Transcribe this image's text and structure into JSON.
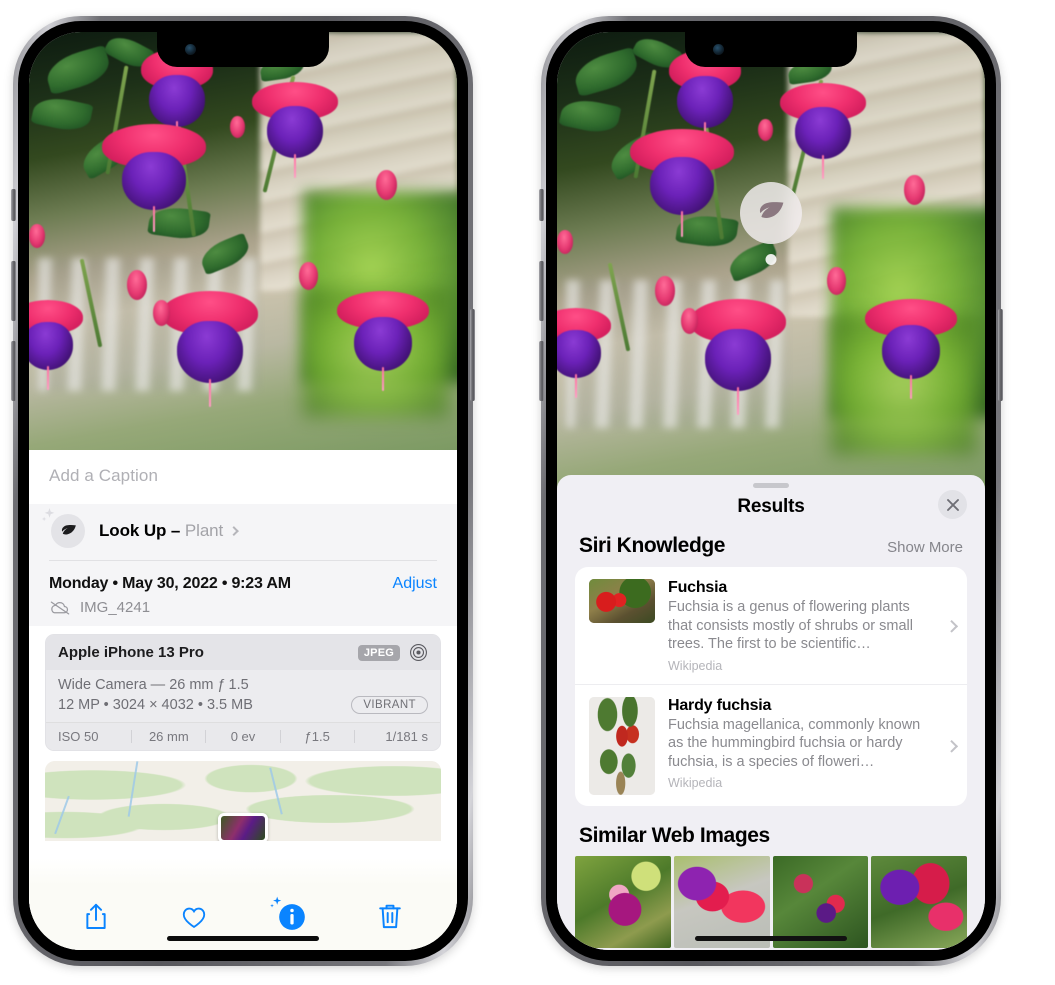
{
  "left_phone": {
    "photo_alt": "Fuchsia flowers hanging basket",
    "caption_placeholder": "Add a Caption",
    "lookup": {
      "label": "Look Up – ",
      "subject": "Plant",
      "icon": "leaf-icon",
      "sparkle_icon": "sparkle-icon"
    },
    "date": "Monday • May 30, 2022 • 9:23 AM",
    "adjust_label": "Adjust",
    "file_name": "IMG_4241",
    "cloud_icon": "icloud-slash-icon",
    "camera": {
      "device": "Apple iPhone 13 Pro",
      "format_chip": "JPEG",
      "aperture_icon": "aperture-icon",
      "lens_line": "Wide Camera — 26 mm ƒ 1.5",
      "size_line": "12 MP • 3024 × 4032 • 3.5 MB",
      "style_chip": "VIBRANT",
      "exif": [
        "ISO 50",
        "26 mm",
        "0 ev",
        "ƒ1.5",
        "1/181 s"
      ]
    },
    "toolbar": [
      {
        "name": "share-button",
        "icon": "share-icon"
      },
      {
        "name": "favorite-button",
        "icon": "heart-icon"
      },
      {
        "name": "info-visual-lookup-button",
        "icon": "info-sparkle-icon"
      },
      {
        "name": "delete-button",
        "icon": "trash-icon"
      }
    ],
    "accent_color": "#0a84ff"
  },
  "right_phone": {
    "visual_lookup_badge_icon": "leaf-icon",
    "results_title": "Results",
    "close_icon": "close-icon",
    "sections": [
      {
        "title": "Siri Knowledge",
        "action": "Show More",
        "items": [
          {
            "title": "Fuchsia",
            "description": "Fuchsia is a genus of flowering plants that consists mostly of shrubs or small trees. The first to be scientific…",
            "source": "Wikipedia",
            "thumb": "fuchsia-red-flowers-thumb"
          },
          {
            "title": "Hardy fuchsia",
            "description": "Fuchsia magellanica, commonly known as the hummingbird fuchsia or hardy fuchsia, is a species of floweri…",
            "source": "Wikipedia",
            "thumb": "hardy-fuchsia-herbarium-thumb"
          }
        ]
      },
      {
        "title": "Similar Web Images",
        "items": [
          {
            "thumb": "web-image-1"
          },
          {
            "thumb": "web-image-2"
          },
          {
            "thumb": "web-image-3"
          },
          {
            "thumb": "web-image-4"
          }
        ]
      }
    ]
  }
}
